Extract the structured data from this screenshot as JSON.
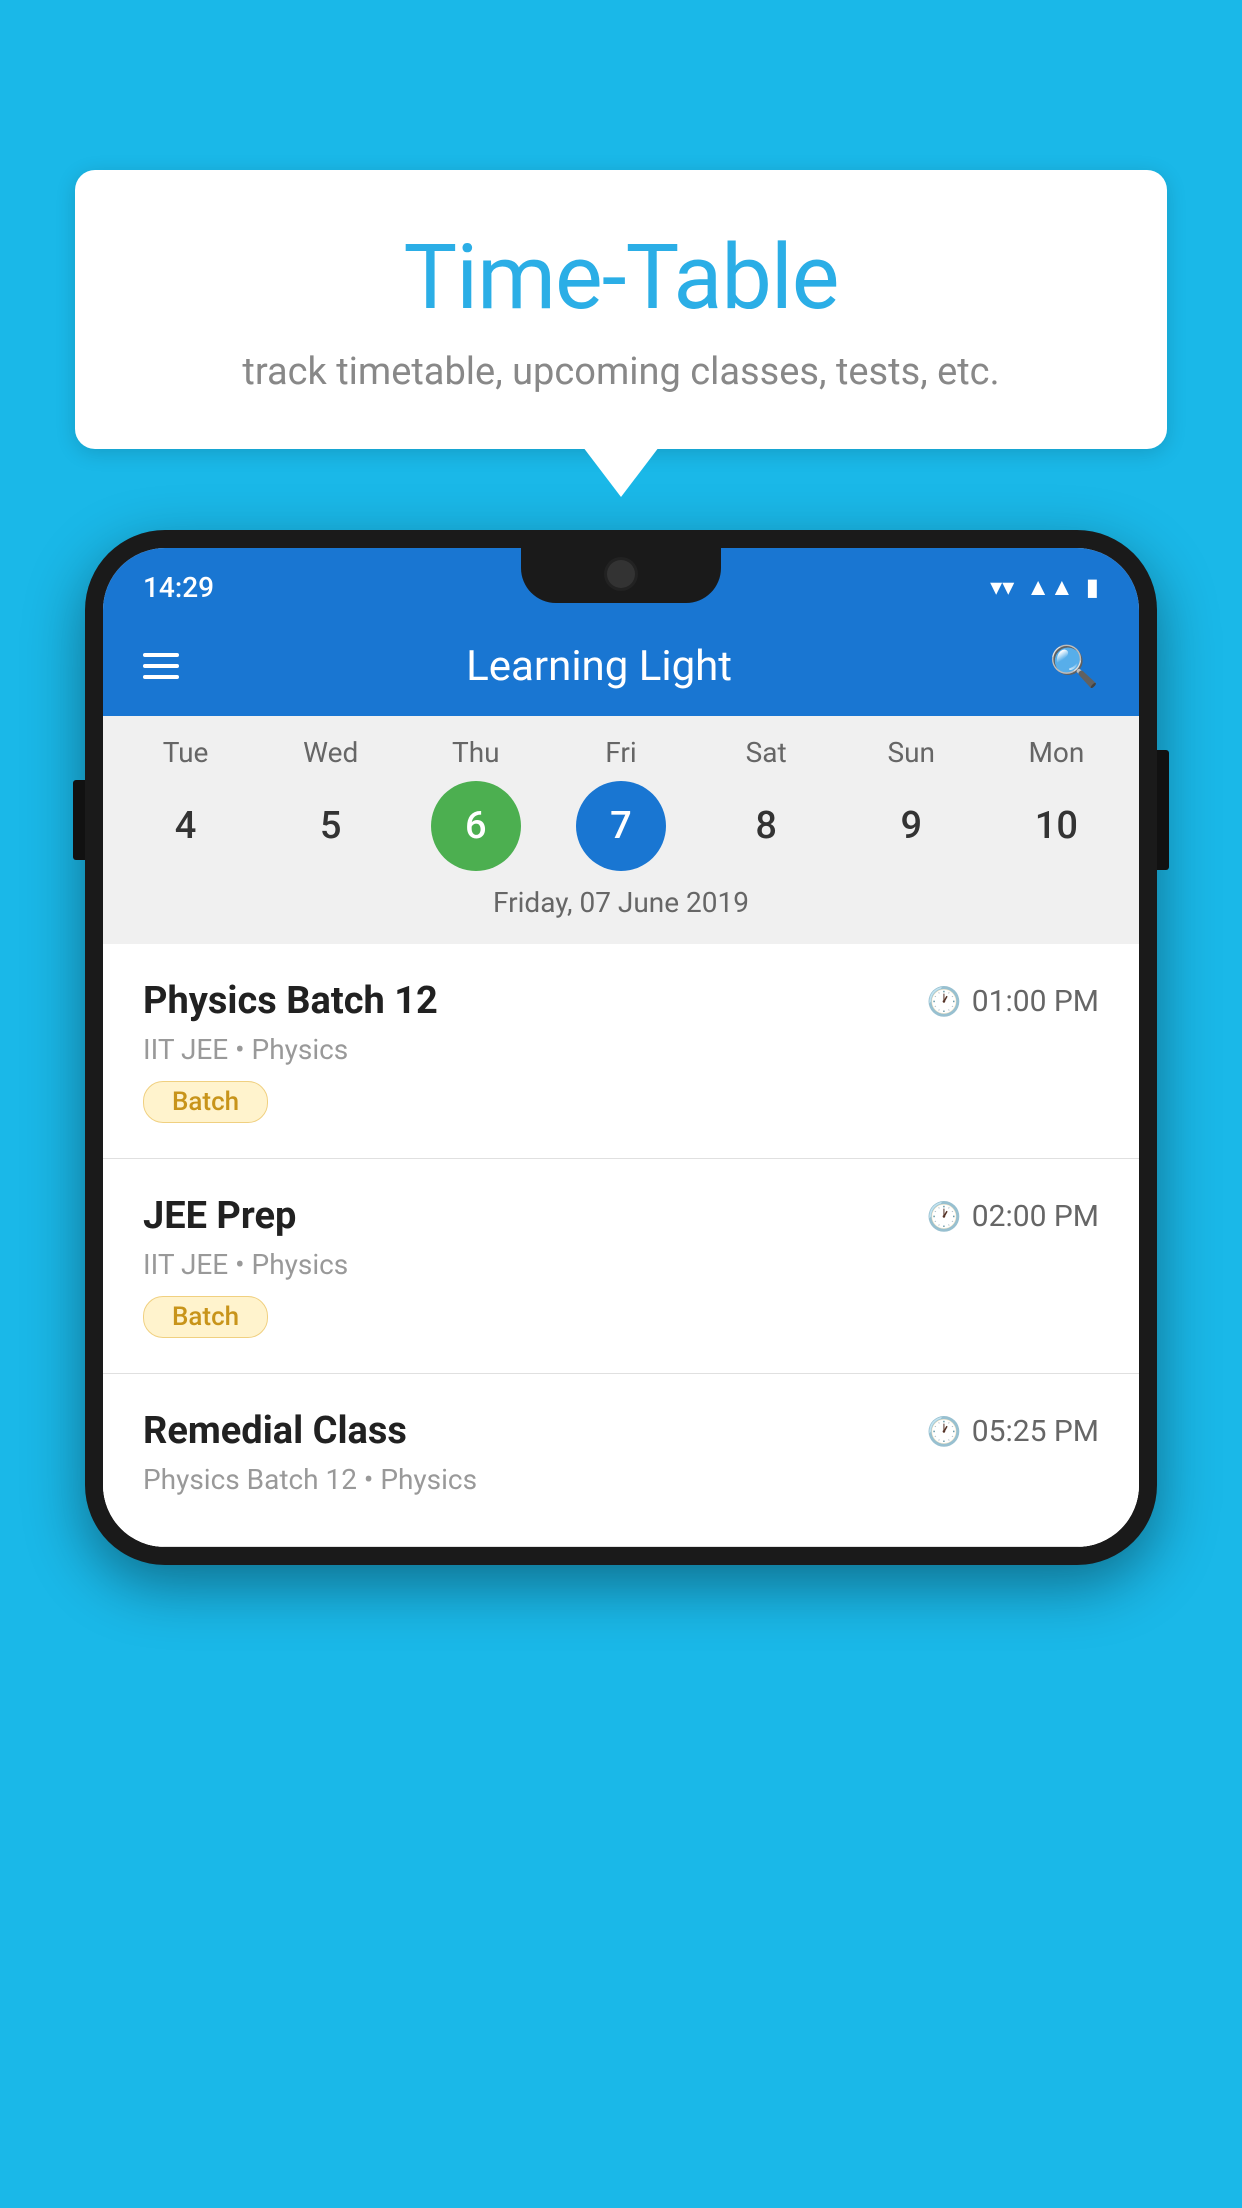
{
  "background_color": "#1ab8e8",
  "speech_bubble": {
    "title": "Time-Table",
    "subtitle": "track timetable, upcoming classes, tests, etc."
  },
  "status_bar": {
    "time": "14:29"
  },
  "app_bar": {
    "title": "Learning Light"
  },
  "calendar": {
    "days": [
      "Tue",
      "Wed",
      "Thu",
      "Fri",
      "Sat",
      "Sun",
      "Mon"
    ],
    "dates": [
      "4",
      "5",
      "6",
      "7",
      "8",
      "9",
      "10"
    ],
    "today_index": 2,
    "selected_index": 3,
    "selected_label": "Friday, 07 June 2019"
  },
  "schedule_items": [
    {
      "title": "Physics Batch 12",
      "time": "01:00 PM",
      "subtitle": "IIT JEE • Physics",
      "badge": "Batch"
    },
    {
      "title": "JEE Prep",
      "time": "02:00 PM",
      "subtitle": "IIT JEE • Physics",
      "badge": "Batch"
    },
    {
      "title": "Remedial Class",
      "time": "05:25 PM",
      "subtitle": "Physics Batch 12 • Physics",
      "badge": ""
    }
  ],
  "icons": {
    "hamburger": "☰",
    "search": "⌕",
    "clock": "🕐"
  }
}
